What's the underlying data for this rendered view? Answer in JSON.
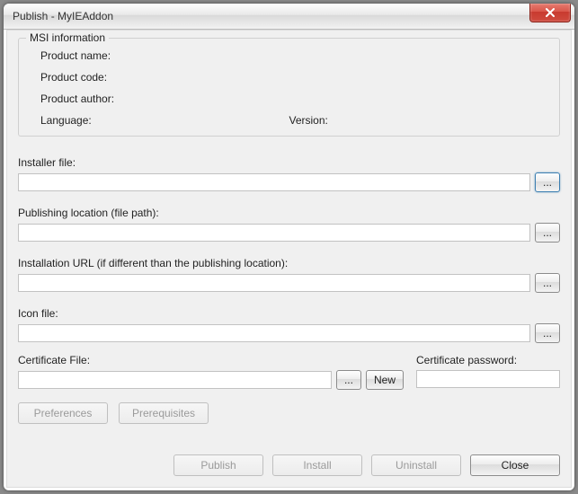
{
  "window": {
    "title": "Publish - MyIEAddon"
  },
  "group": {
    "legend": "MSI information",
    "productNameLabel": "Product name:",
    "productNameValue": "",
    "productCodeLabel": "Product code:",
    "productCodeValue": "",
    "productAuthorLabel": "Product author:",
    "productAuthorValue": "",
    "languageLabel": "Language:",
    "languageValue": "",
    "versionLabel": "Version:",
    "versionValue": ""
  },
  "installer": {
    "label": "Installer file:",
    "value": "",
    "browse": "..."
  },
  "publishing": {
    "label": "Publishing location (file path):",
    "value": "",
    "browse": "..."
  },
  "installationUrl": {
    "label": "Installation URL (if different than the publishing location):",
    "value": "",
    "browse": "..."
  },
  "iconFile": {
    "label": "Icon file:",
    "value": "",
    "browse": "..."
  },
  "certificate": {
    "fileLabel": "Certificate File:",
    "fileValue": "",
    "browse": "...",
    "newLabel": "New",
    "passwordLabel": "Certificate password:",
    "passwordValue": ""
  },
  "prefs": {
    "preferences": "Preferences",
    "prerequisites": "Prerequisites"
  },
  "actions": {
    "publish": "Publish",
    "install": "Install",
    "uninstall": "Uninstall",
    "close": "Close"
  }
}
